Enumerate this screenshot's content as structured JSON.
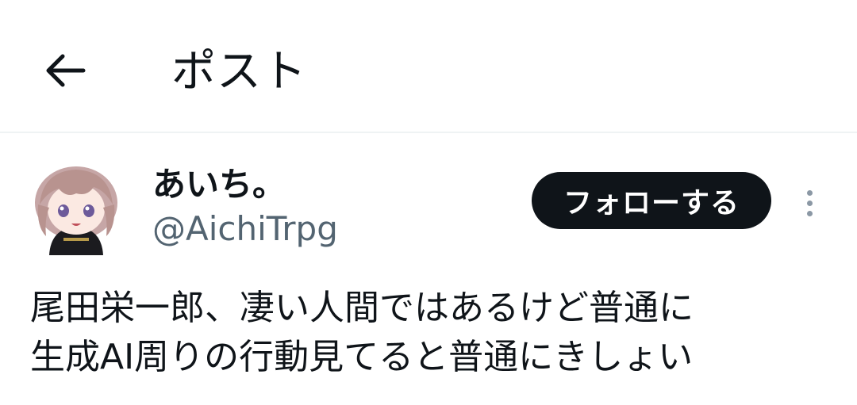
{
  "header": {
    "back_icon": "arrow-left-icon",
    "title": "ポスト"
  },
  "post": {
    "author": {
      "display_name": "あいち。",
      "handle": "@AichiTrpg",
      "avatar_icon": "avatar-illustration"
    },
    "follow_label": "フォローする",
    "more_icon": "more-vertical-icon",
    "text_lines": [
      "尾田栄一郎、凄い人間ではあるけど普通に",
      "生成AI周りの行動見てると普通にきしょい"
    ]
  },
  "colors": {
    "text_primary": "#0f1419",
    "text_secondary": "#536471",
    "follow_bg": "#0f1419",
    "follow_text": "#ffffff",
    "divider": "#eff3f4",
    "more_dots": "#8b98a5"
  }
}
